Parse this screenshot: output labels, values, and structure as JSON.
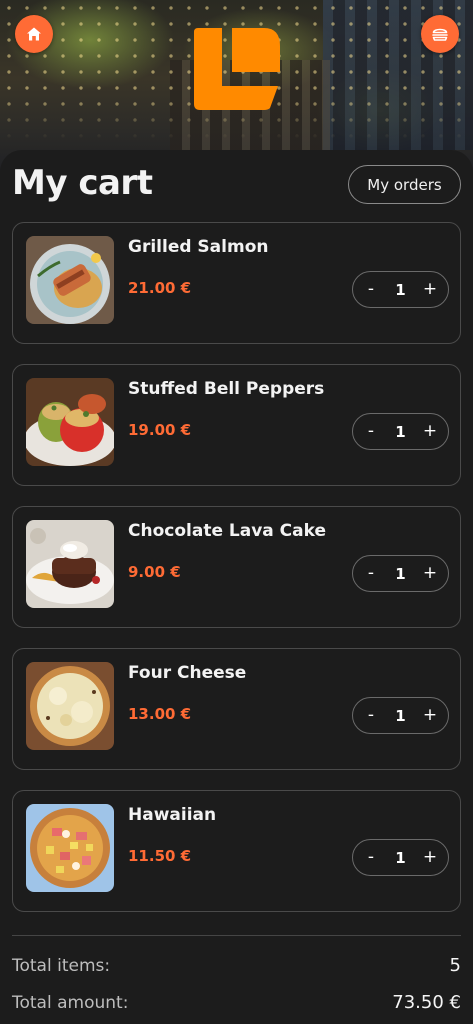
{
  "header": {
    "home_icon": "home-icon",
    "menu_icon": "burger-icon",
    "logo": "restaurant-logo",
    "accent_color": "#ff6b35"
  },
  "page": {
    "title": "My cart",
    "orders_button": "My orders"
  },
  "cart": {
    "items": [
      {
        "name": "Grilled Salmon",
        "price": "21.00 €",
        "quantity": "1"
      },
      {
        "name": "Stuffed Bell Peppers",
        "price": "19.00 €",
        "quantity": "1"
      },
      {
        "name": "Chocolate Lava Cake",
        "price": "9.00 €",
        "quantity": "1"
      },
      {
        "name": "Four Cheese",
        "price": "13.00 €",
        "quantity": "1"
      },
      {
        "name": "Hawaiian",
        "price": "11.50 €",
        "quantity": "1"
      }
    ],
    "minus_label": "-",
    "plus_label": "+"
  },
  "totals": {
    "items_label": "Total items:",
    "items_value": "5",
    "amount_label": "Total amount:",
    "amount_value": "73.50 €"
  }
}
